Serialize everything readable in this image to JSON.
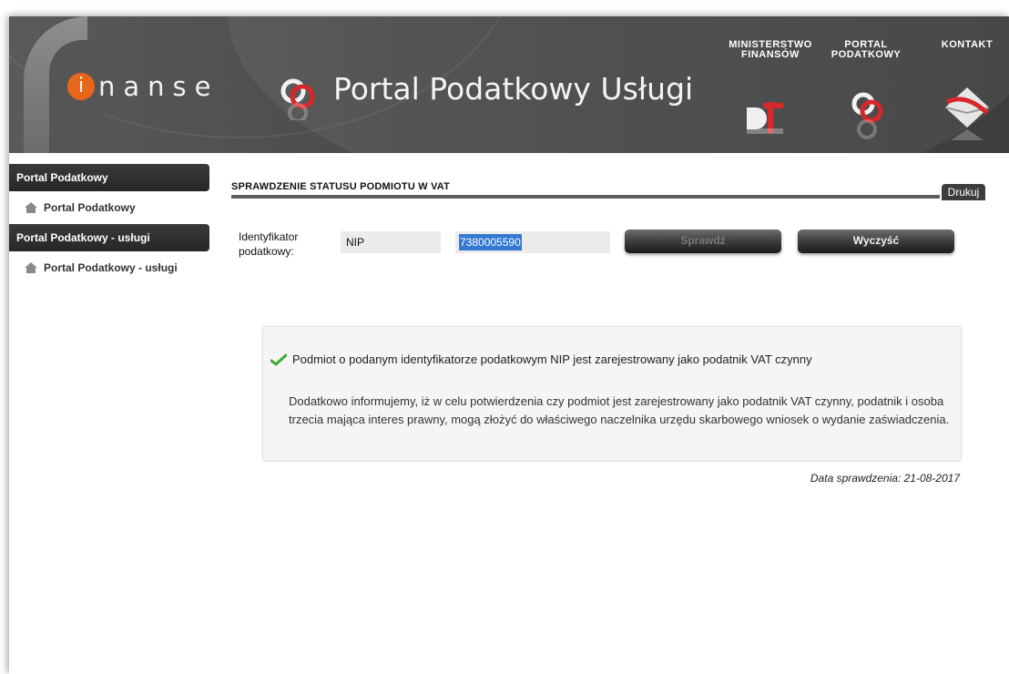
{
  "header": {
    "logo_i": "i",
    "logo_text": "nanse",
    "portal_title": "Portal Podatkowy Usługi",
    "links": {
      "ministry": [
        "MINISTERSTWO",
        "FINANSÓW"
      ],
      "portal": [
        "PORTAL",
        "PODATKOWY"
      ],
      "contact": "KONTAKT"
    }
  },
  "sidebar": {
    "sections": [
      {
        "header": "Portal Podatkowy",
        "item": "Portal Podatkowy"
      },
      {
        "header": "Portal Podatkowy - usługi",
        "item": "Portal Podatkowy - usługi"
      }
    ]
  },
  "main": {
    "title": "SPRAWDZENIE STATUSU PODMIOTU W VAT",
    "print_label": "Drukuj",
    "form": {
      "label_line1": "Identyfikator",
      "label_line2": "podatkowy:",
      "id_type": "NIP",
      "id_value": "7380005590",
      "check_label": "Sprawdź",
      "clear_label": "Wyczyść"
    },
    "result": {
      "status": "Podmiot o podanym identyfikatorze podatkowym NIP jest zarejestrowany jako podatnik VAT czynny",
      "info": "Dodatkowo informujemy, iż w celu potwierdzenia czy podmiot jest zarejestrowany jako podatnik VAT czynny, podatnik i osoba trzecia mająca interes prawny, mogą złożyć do właściwego naczelnika urzędu skarbowego wniosek o wydanie zaświadczenia."
    },
    "check_date": "Data sprawdzenia: 21-08-2017"
  },
  "colors": {
    "accent_orange": "#e8661c",
    "portal_red": "#d6282a",
    "header_gray": "#4a4a4a",
    "check_green": "#3aaa35"
  }
}
